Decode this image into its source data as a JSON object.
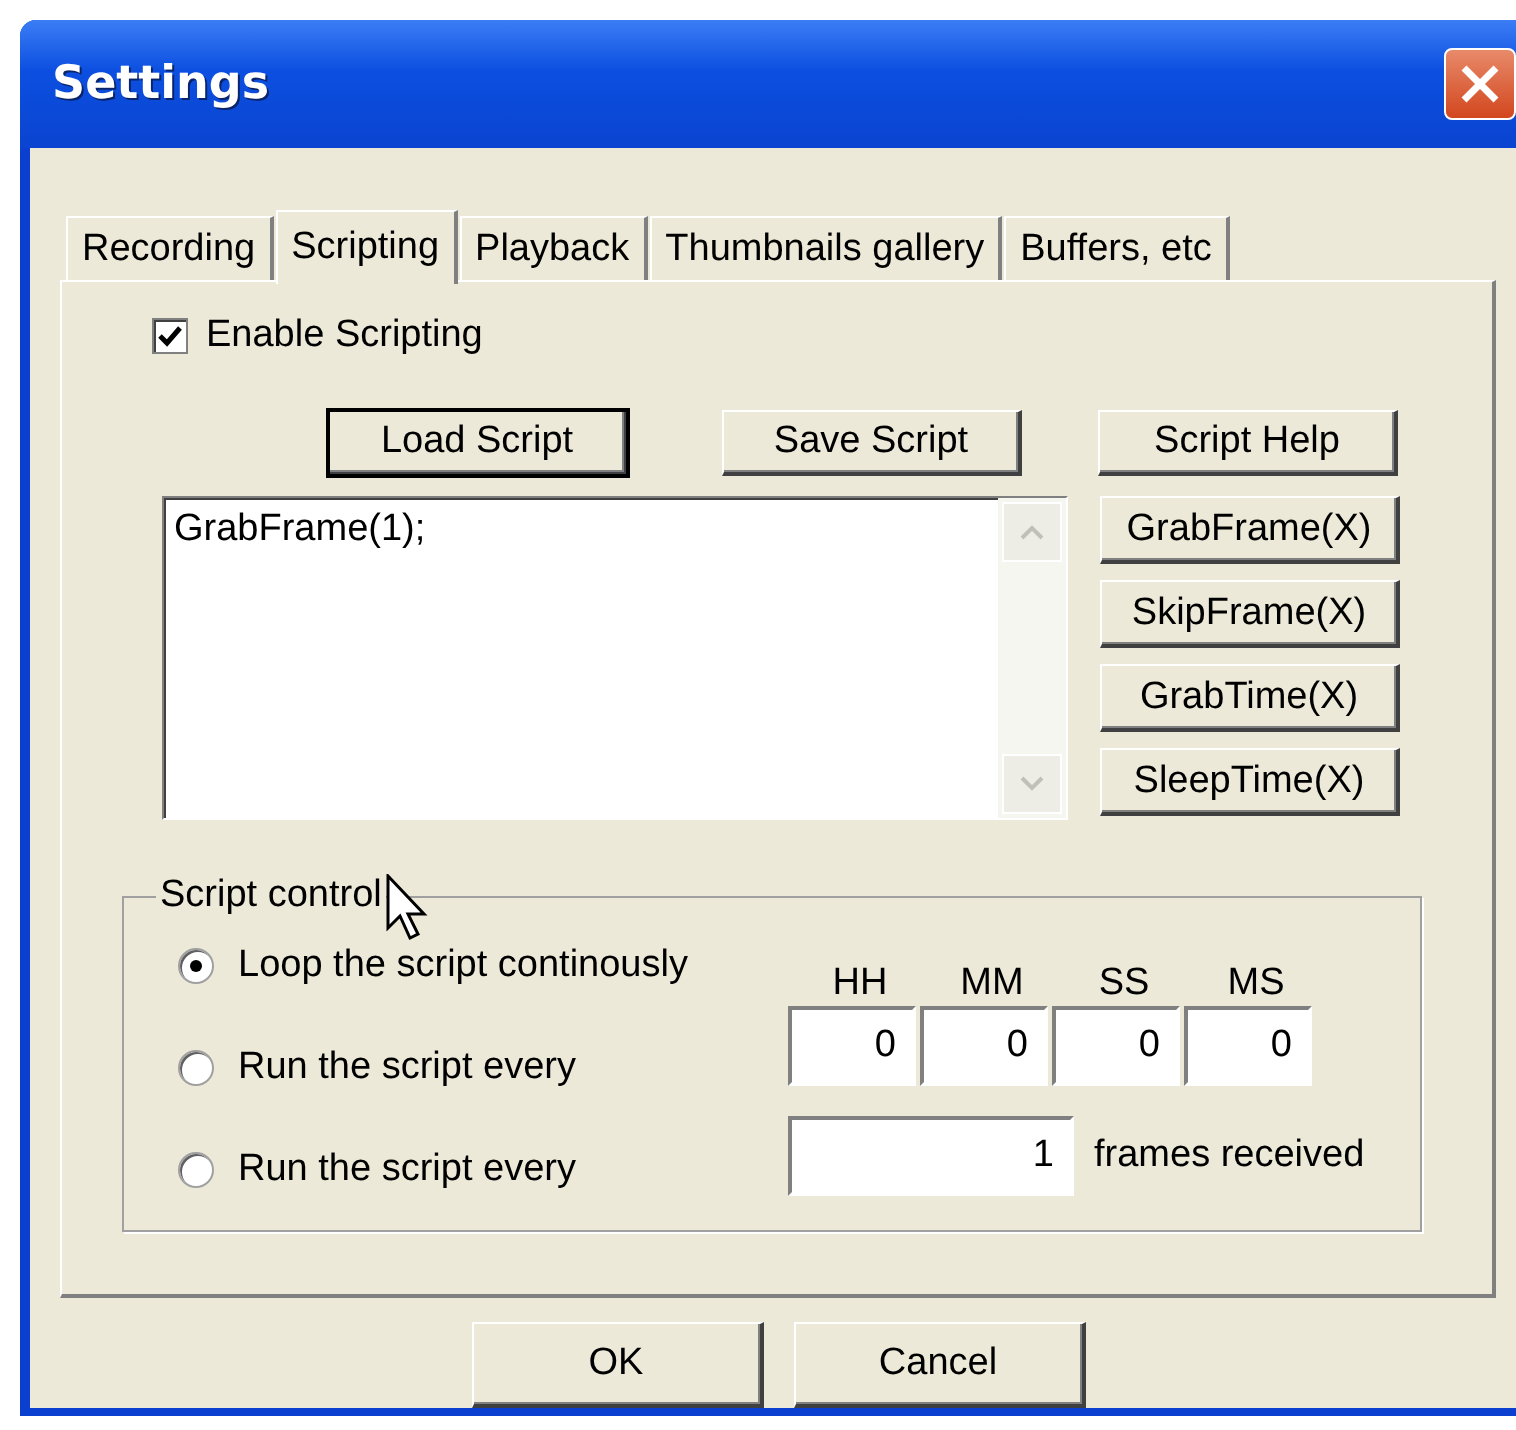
{
  "window": {
    "title": "Settings"
  },
  "tabs": [
    {
      "label": "Recording",
      "selected": false
    },
    {
      "label": "Scripting",
      "selected": true
    },
    {
      "label": "Playback",
      "selected": false
    },
    {
      "label": "Thumbnails gallery",
      "selected": false
    },
    {
      "label": "Buffers, etc",
      "selected": false
    }
  ],
  "enable_scripting": {
    "label": "Enable Scripting",
    "checked": true
  },
  "script_buttons": [
    {
      "label": "Load Script",
      "default": true
    },
    {
      "label": "Save Script",
      "default": false
    },
    {
      "label": "Script Help",
      "default": false
    }
  ],
  "script_text": "GrabFrame(1);",
  "command_buttons": [
    "GrabFrame(X)",
    "SkipFrame(X)",
    "GrabTime(X)",
    "SleepTime(X)"
  ],
  "script_control": {
    "legend": "Script control",
    "options": [
      {
        "label": "Loop the script continously",
        "selected": true
      },
      {
        "label": "Run the script every",
        "selected": false
      },
      {
        "label": "Run the script every",
        "selected": false
      }
    ],
    "time_labels": [
      "HH",
      "MM",
      "SS",
      "MS"
    ],
    "time_values": [
      "0",
      "0",
      "0",
      "0"
    ],
    "frames_value": "1",
    "frames_label": "frames received"
  },
  "dialog_buttons": [
    "OK",
    "Cancel"
  ]
}
